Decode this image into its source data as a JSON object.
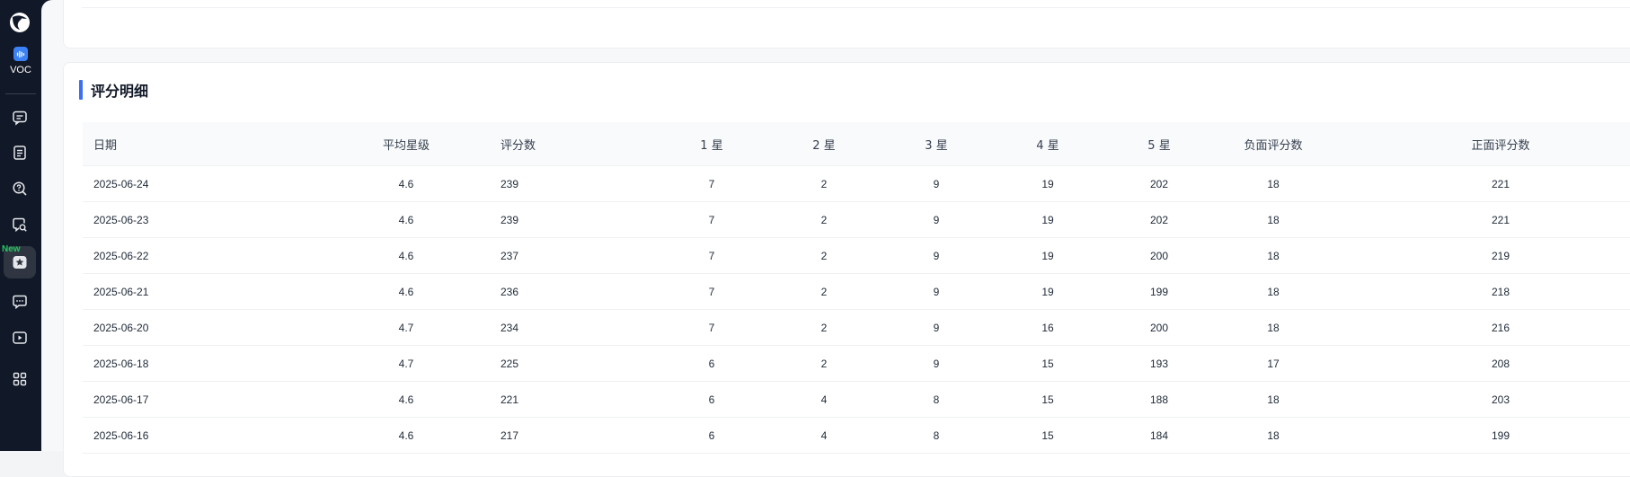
{
  "sidebar": {
    "app_label": "VOC",
    "new_badge": "New",
    "items": [
      {
        "icon": "chat-bubble-icon"
      },
      {
        "icon": "document-icon"
      },
      {
        "icon": "search-question-icon"
      },
      {
        "icon": "chat-search-icon"
      },
      {
        "icon": "star-icon",
        "active": true
      },
      {
        "icon": "message-dots-icon"
      },
      {
        "icon": "video-play-icon"
      },
      {
        "icon": "apps-grid-icon"
      }
    ]
  },
  "section": {
    "title": "评分明细"
  },
  "table": {
    "columns": [
      "日期",
      "平均星级",
      "评分数",
      "1 星",
      "2 星",
      "3 星",
      "4 星",
      "5 星",
      "负面评分数",
      "正面评分数"
    ],
    "rows": [
      [
        "2025-06-24",
        "4.6",
        "239",
        "7",
        "2",
        "9",
        "19",
        "202",
        "18",
        "221"
      ],
      [
        "2025-06-23",
        "4.6",
        "239",
        "7",
        "2",
        "9",
        "19",
        "202",
        "18",
        "221"
      ],
      [
        "2025-06-22",
        "4.6",
        "237",
        "7",
        "2",
        "9",
        "19",
        "200",
        "18",
        "219"
      ],
      [
        "2025-06-21",
        "4.6",
        "236",
        "7",
        "2",
        "9",
        "19",
        "199",
        "18",
        "218"
      ],
      [
        "2025-06-20",
        "4.7",
        "234",
        "7",
        "2",
        "9",
        "16",
        "200",
        "18",
        "216"
      ],
      [
        "2025-06-18",
        "4.7",
        "225",
        "6",
        "2",
        "9",
        "15",
        "193",
        "17",
        "208"
      ],
      [
        "2025-06-17",
        "4.6",
        "221",
        "6",
        "4",
        "8",
        "15",
        "188",
        "18",
        "203"
      ],
      [
        "2025-06-16",
        "4.6",
        "217",
        "6",
        "4",
        "8",
        "15",
        "184",
        "18",
        "199"
      ]
    ]
  },
  "colors": {
    "sidebar_bg": "#111827",
    "accent": "#3b6ff5",
    "new_badge": "#22c55e"
  }
}
